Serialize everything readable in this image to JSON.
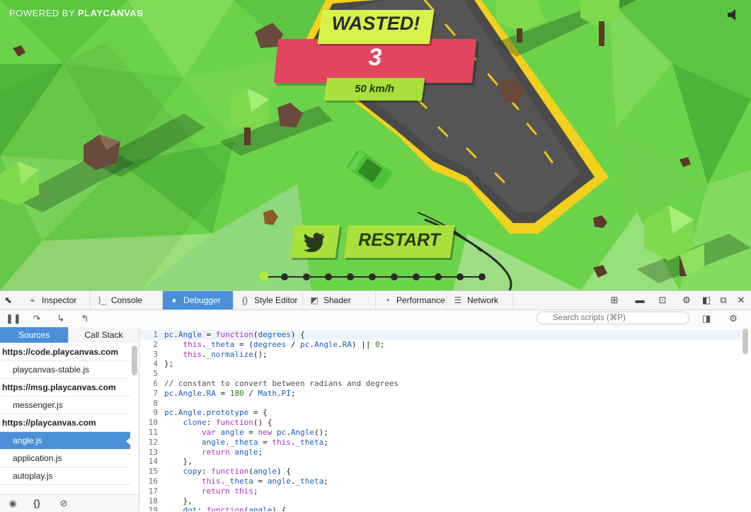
{
  "game": {
    "powered_prefix": "POWERED BY ",
    "powered_brand": "PLAYCANVAS",
    "wasted": "WASTED!",
    "score": "3",
    "speed": "50 km/h",
    "restart": "RESTART",
    "progress": {
      "total_dots": 11,
      "active_index": 0
    },
    "colors": {
      "grass": "#6bd34a",
      "road": "#4a4a4a",
      "road_edge": "#f2d01e",
      "banner_red": "#e2455f",
      "banner_lime": "#a9e03b",
      "car": "#4ec23a"
    }
  },
  "devtools": {
    "tabs": [
      {
        "label": "Inspector",
        "icon": "inspector-icon"
      },
      {
        "label": "Console",
        "icon": "console-icon"
      },
      {
        "label": "Debugger",
        "icon": "debugger-icon",
        "selected": true
      },
      {
        "label": "Style Editor",
        "icon": "style-editor-icon"
      },
      {
        "label": "Shader Editor",
        "icon": "shader-editor-icon"
      },
      {
        "label": "Performance",
        "icon": "performance-icon"
      },
      {
        "label": "Network",
        "icon": "network-icon"
      }
    ],
    "search_placeholder": "Search scripts (⌘P)",
    "sidebar": {
      "tab_sources": "Sources",
      "tab_callstack": "Call Stack",
      "tree": [
        {
          "type": "host",
          "label": "https://code.playcanvas.com"
        },
        {
          "type": "file",
          "label": "playcanvas-stable.js"
        },
        {
          "type": "host",
          "label": "https://msg.playcanvas.com"
        },
        {
          "type": "file",
          "label": "messenger.js"
        },
        {
          "type": "host",
          "label": "https://playcanvas.com"
        },
        {
          "type": "file",
          "label": "angle.js",
          "selected": true
        },
        {
          "type": "file",
          "label": "application.js"
        },
        {
          "type": "file",
          "label": "autoplay.js"
        }
      ]
    },
    "code_lines": [
      "pc.Angle = function(degrees) {",
      "    this._theta = (degrees / pc.Angle.RA) || 0;",
      "    this._normalize();",
      "};",
      "",
      "// constant to convert between radians and degrees",
      "pc.Angle.RA = 180 / Math.PI;",
      "",
      "pc.Angle.prototype = {",
      "    clone: function() {",
      "        var angle = new pc.Angle();",
      "        angle._theta = this._theta;",
      "        return angle;",
      "    },",
      "    copy: function(angle) {",
      "        this._theta = angle._theta;",
      "        return this;",
      "    },",
      "    dot: function(angle) {"
    ],
    "line_numbers": [
      "1",
      "2",
      "3",
      "4",
      "5",
      "6",
      "7",
      "8",
      "9",
      "10",
      "11",
      "12",
      "13",
      "14",
      "15",
      "16",
      "17",
      "18",
      "19"
    ]
  }
}
